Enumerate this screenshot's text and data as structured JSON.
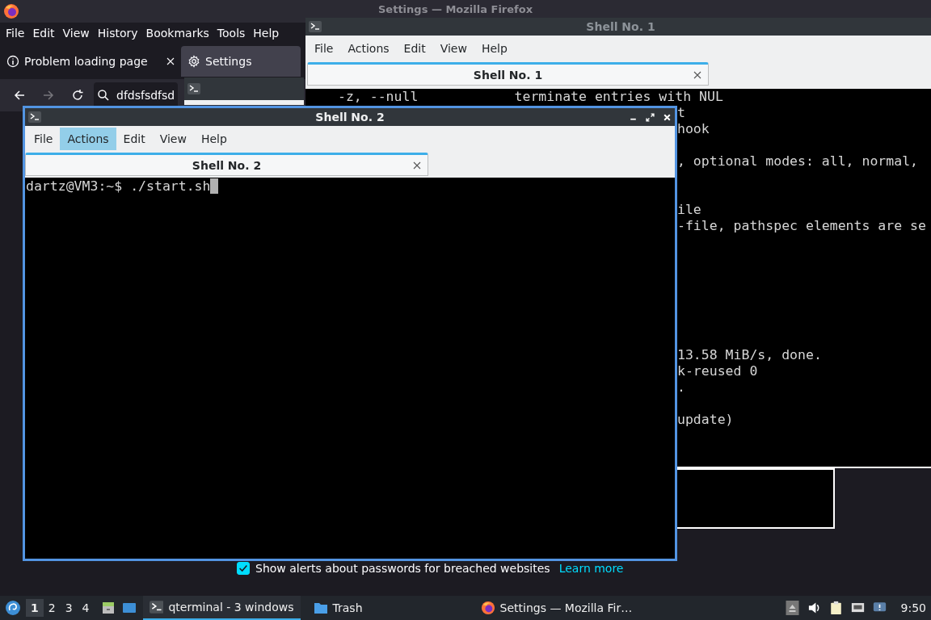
{
  "firefox": {
    "title": "Settings — Mozilla Firefox",
    "menu": [
      "File",
      "Edit",
      "View",
      "History",
      "Bookmarks",
      "Tools",
      "Help"
    ],
    "tabs": [
      {
        "label": "Problem loading page",
        "selected": false,
        "kind": "info"
      },
      {
        "label": "Settings",
        "selected": true,
        "kind": "settings"
      }
    ],
    "url": "dfdsfsdfsd",
    "checkbox": {
      "label": "Show alerts about passwords for breached websites",
      "checked": true
    },
    "link": "Learn more"
  },
  "shell1": {
    "title": "Shell No. 1",
    "menu": [
      {
        "label": "File",
        "selected": false
      },
      {
        "label": "Actions",
        "selected": false
      },
      {
        "label": "Edit",
        "selected": false
      },
      {
        "label": "View",
        "selected": false
      },
      {
        "label": "Help",
        "selected": false
      }
    ],
    "tab": "Shell No. 1",
    "lines": [
      "-z, --null            terminate entries with NUL",
      "t",
      "hook",
      ", optional modes: all, normal, ",
      "ile",
      "-file, pathspec elements are se",
      "13.58 MiB/s, done.",
      "k-reused 0",
      ".",
      "update)"
    ]
  },
  "shell2": {
    "title": "Shell No. 2",
    "menu": [
      {
        "label": "File",
        "selected": false
      },
      {
        "label": "Actions",
        "selected": true
      },
      {
        "label": "Edit",
        "selected": false
      },
      {
        "label": "View",
        "selected": false
      },
      {
        "label": "Help",
        "selected": false
      }
    ],
    "tab": "Shell No. 2",
    "prompt": "dartz@VM3:~$ ./start.sh"
  },
  "taskbar": {
    "workspaces": [
      {
        "label": "1",
        "selected": true
      },
      {
        "label": "2",
        "selected": false
      },
      {
        "label": "3",
        "selected": false
      },
      {
        "label": "4",
        "selected": false
      }
    ],
    "tasks": [
      {
        "label": "qterminal - 3 windows",
        "selected": true,
        "kind": "terminal"
      },
      {
        "label": "Trash",
        "selected": false,
        "kind": "folder"
      },
      {
        "label": "Settings — Mozilla Fir…",
        "selected": false,
        "kind": "firefox"
      }
    ],
    "clock": "9:50"
  }
}
